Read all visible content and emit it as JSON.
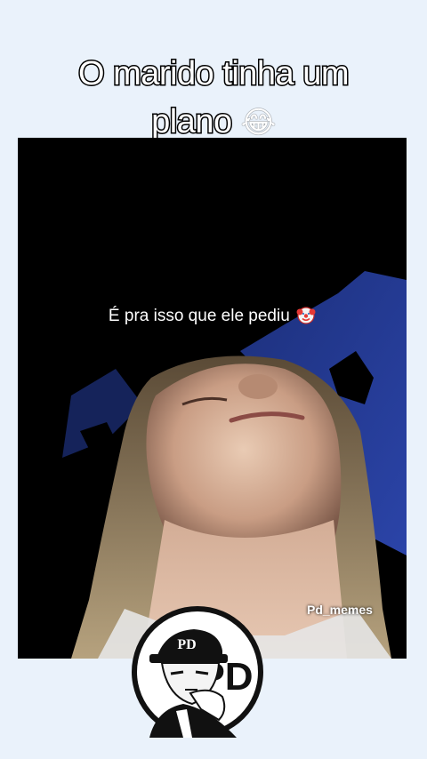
{
  "headline": {
    "line1": "O marido tinha um",
    "line2": "plano",
    "emoji": "😂"
  },
  "video": {
    "caption": "É pra isso que ele pediu",
    "caption_emoji": "clown-face-icon",
    "watermark": "Pd_memes"
  },
  "logo": {
    "letters": "PD",
    "cap_letters": "PD"
  },
  "colors": {
    "page_background": "#eaf2fb",
    "headline_fill": "#ffffff",
    "headline_stroke": "#000000",
    "sky_blue": "#1e3a8a",
    "night_black": "#000000"
  }
}
